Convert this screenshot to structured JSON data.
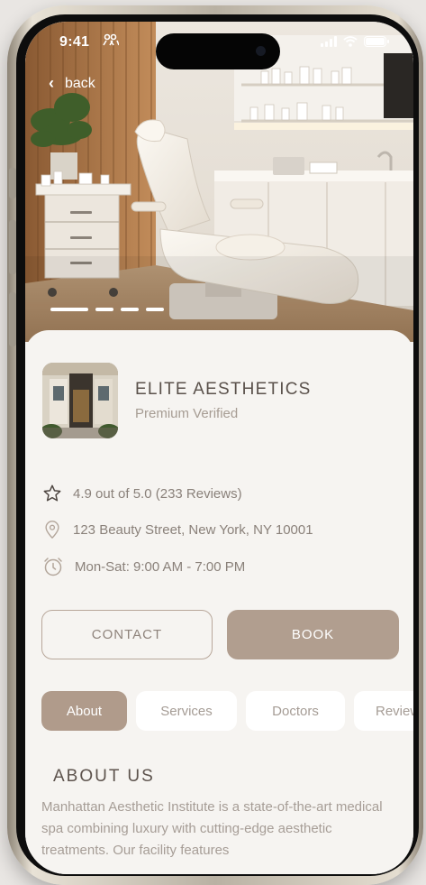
{
  "status_bar": {
    "time": "9:41",
    "people_glyph": "὆5"
  },
  "nav": {
    "back_label": "back"
  },
  "carousel": {
    "total": 4,
    "active_index": 0
  },
  "clinic": {
    "name": "ELITE AESTHETICS",
    "subtitle": "Premium Verified",
    "rating_text": "4.9 out of 5.0 (233 Reviews)",
    "address": "123 Beauty Street, New York, NY 10001",
    "hours": "Mon-Sat: 9:00 AM - 7:00 PM"
  },
  "actions": {
    "contact_label": "CONTACT",
    "book_label": "BOOK"
  },
  "tabs": [
    {
      "label": "About",
      "active": true
    },
    {
      "label": "Services",
      "active": false
    },
    {
      "label": "Doctors",
      "active": false
    },
    {
      "label": "Reviews",
      "active": false
    }
  ],
  "about": {
    "title": "ABOUT US",
    "body": "Manhattan Aesthetic Institute is a state-of-the-art medical spa combining luxury with cutting-edge aesthetic treatments. Our facility features"
  },
  "colors": {
    "accent": "#b19e8f",
    "card_bg": "#f6f4f1",
    "text_dark": "#5a514b",
    "text_muted": "#a69c93"
  },
  "icons": {
    "back": "chevron-left-icon",
    "rating": "star-icon",
    "address": "location-pin-icon",
    "hours": "alarm-clock-icon"
  }
}
